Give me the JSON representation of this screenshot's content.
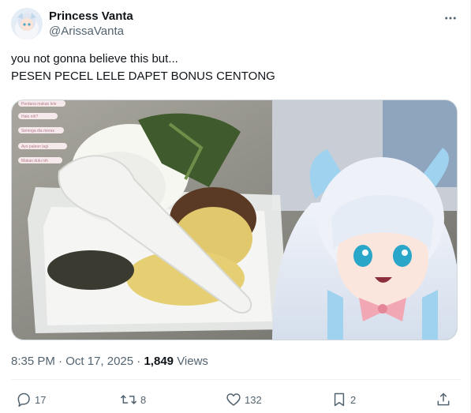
{
  "author": {
    "display_name": "Princess Vanta",
    "handle": "@ArissaVanta"
  },
  "tweet": {
    "lines": [
      "you not gonna believe this but...",
      "PESEN PECEL LELE DAPET BONUS CENTONG"
    ]
  },
  "media": {
    "chat_overlay": [
      "Perdana makan lele",
      "Halo nih?",
      "Semoga dia meras",
      "Ayo paleon lagi",
      "Makan dulu nih"
    ]
  },
  "meta": {
    "time": "8:35 PM",
    "separator": "·",
    "date": "Oct 17, 2025",
    "views_count": "1,849",
    "views_label": "Views"
  },
  "actions": {
    "reply_count": "17",
    "repost_count": "8",
    "like_count": "132",
    "bookmark_count": "2"
  },
  "icons": {
    "more": "more-icon",
    "reply": "reply-icon",
    "repost": "repost-icon",
    "like": "heart-icon",
    "bookmark": "bookmark-icon",
    "share": "share-icon"
  },
  "colors": {
    "text": "#0f1419",
    "secondary": "#536471",
    "border": "#cfd9de"
  }
}
